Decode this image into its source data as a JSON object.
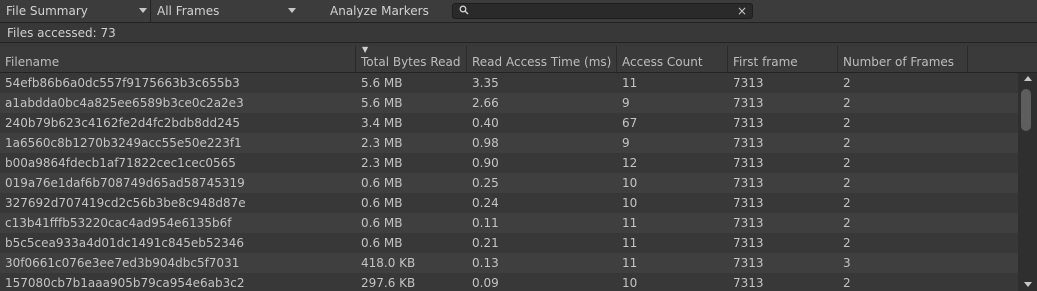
{
  "toolbar": {
    "view_dropdown": "File Summary",
    "frames_dropdown": "All Frames",
    "analyze_label": "Analyze Markers",
    "search_value": "",
    "search_icon": "search-icon",
    "clear_icon": "close-icon"
  },
  "summary": {
    "files_accessed": "Files accessed: 73"
  },
  "table": {
    "columns": [
      "Filename",
      "Total Bytes Read",
      "Read Access Time (ms)",
      "Access Count",
      "First frame",
      "Number of Frames"
    ],
    "sorted_column": "Total Bytes Read",
    "rows": [
      [
        "54efb86b6a0dc557f9175663b3c655b3",
        "5.6 MB",
        "3.35",
        "11",
        "7313",
        "2"
      ],
      [
        "a1abdda0bc4a825ee6589b3ce0c2a2e3",
        "5.6 MB",
        "2.66",
        "9",
        "7313",
        "2"
      ],
      [
        "240b79b623c4162fe2d4fc2bdb8dd245",
        "3.4 MB",
        "0.40",
        "67",
        "7313",
        "2"
      ],
      [
        "1a6560c8b1270b3249acc55e50e223f1",
        "2.3 MB",
        "0.98",
        "9",
        "7313",
        "2"
      ],
      [
        "b00a9864fdecb1af71822cec1cec0565",
        "2.3 MB",
        "0.90",
        "12",
        "7313",
        "2"
      ],
      [
        "019a76e1daf6b708749d65ad58745319",
        "0.6 MB",
        "0.25",
        "10",
        "7313",
        "2"
      ],
      [
        "327692d707419cd2c56b3be8c948d87e",
        "0.6 MB",
        "0.24",
        "10",
        "7313",
        "2"
      ],
      [
        "c13b41fffb53220cac4ad954e6135b6f",
        "0.6 MB",
        "0.11",
        "11",
        "7313",
        "2"
      ],
      [
        "b5c5cea933a4d01dc1491c845eb52346",
        "0.6 MB",
        "0.21",
        "11",
        "7313",
        "2"
      ],
      [
        "30f0661c076e3ee7ed3b904dbc5f7031",
        "418.0 KB",
        "0.13",
        "11",
        "7313",
        "3"
      ],
      [
        "157080cb7b1aaa905b79ca954e6ab3c2",
        "297.6 KB",
        "0.09",
        "10",
        "7313",
        "2"
      ]
    ]
  }
}
